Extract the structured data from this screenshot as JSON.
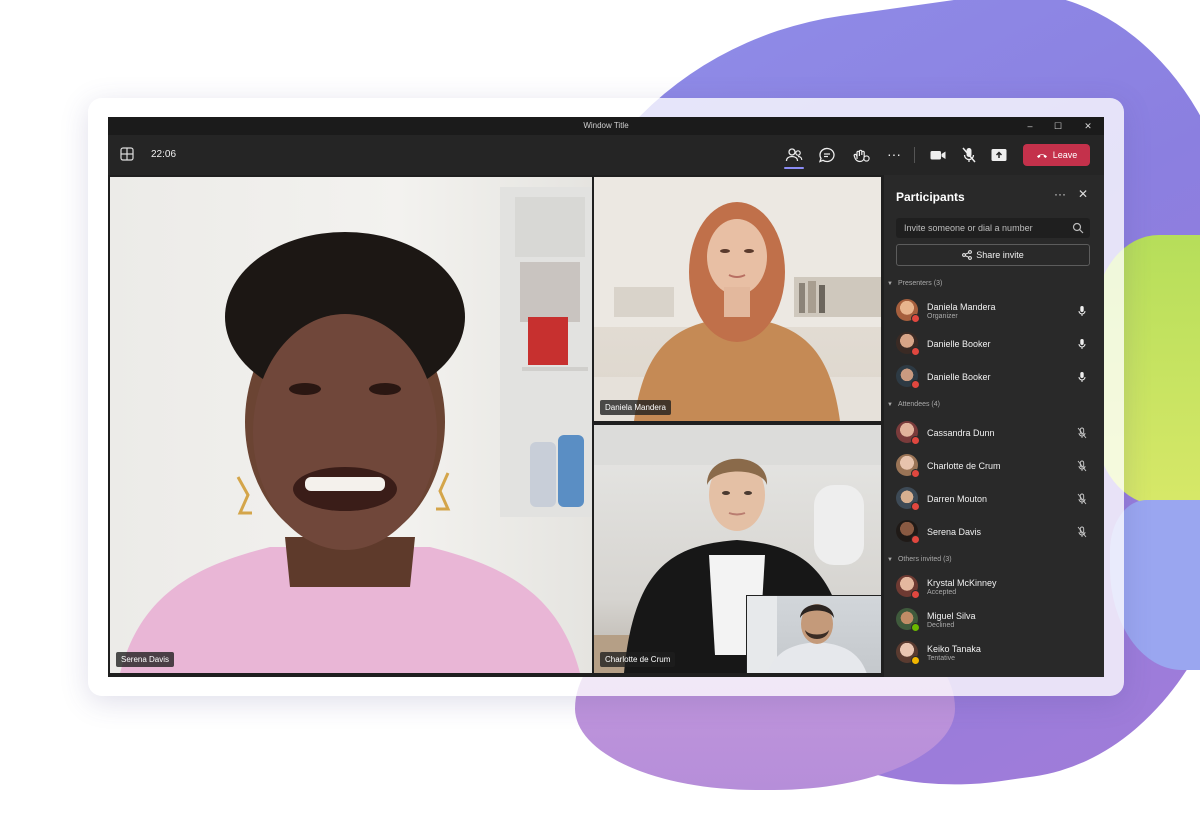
{
  "window": {
    "title": "Window Title",
    "minimize": "–",
    "maximize": "☐",
    "close": "✕"
  },
  "toolbar": {
    "clock": "22:06",
    "leave_label": "Leave"
  },
  "colors": {
    "leave": "#c4314b",
    "accent": "#8b8cf5",
    "panel": "#292929",
    "status_busy": "#e0473f",
    "status_ok": "#6bb700",
    "status_away": "#f2b600"
  },
  "tiles": [
    {
      "name": "Serena Davis"
    },
    {
      "name": "Daniela Mandera"
    },
    {
      "name": "Charlotte de Crum"
    }
  ],
  "panel": {
    "title": "Participants",
    "search_placeholder": "Invite someone or dial a number",
    "share_label": "Share invite",
    "sections": [
      {
        "header": "Presenters (3)",
        "people": [
          {
            "name": "Daniela Mandera",
            "role": "Organizer",
            "mic": "on",
            "status": "busy"
          },
          {
            "name": "Danielle Booker",
            "role": "",
            "mic": "on",
            "status": "busy"
          },
          {
            "name": "Danielle Booker",
            "role": "",
            "mic": "on",
            "status": "busy"
          }
        ]
      },
      {
        "header": "Attendees (4)",
        "people": [
          {
            "name": "Cassandra Dunn",
            "role": "",
            "mic": "muted",
            "status": "busy"
          },
          {
            "name": "Charlotte de Crum",
            "role": "",
            "mic": "muted",
            "status": "busy"
          },
          {
            "name": "Darren Mouton",
            "role": "",
            "mic": "muted",
            "status": "busy"
          },
          {
            "name": "Serena Davis",
            "role": "",
            "mic": "muted",
            "status": "busy"
          }
        ]
      },
      {
        "header": "Others invited (3)",
        "people": [
          {
            "name": "Krystal McKinney",
            "role": "Accepted",
            "mic": "",
            "status": "busy"
          },
          {
            "name": "Miguel Silva",
            "role": "Declined",
            "mic": "",
            "status": "ok"
          },
          {
            "name": "Keiko Tanaka",
            "role": "Tentative",
            "mic": "",
            "status": "away"
          }
        ]
      }
    ]
  }
}
